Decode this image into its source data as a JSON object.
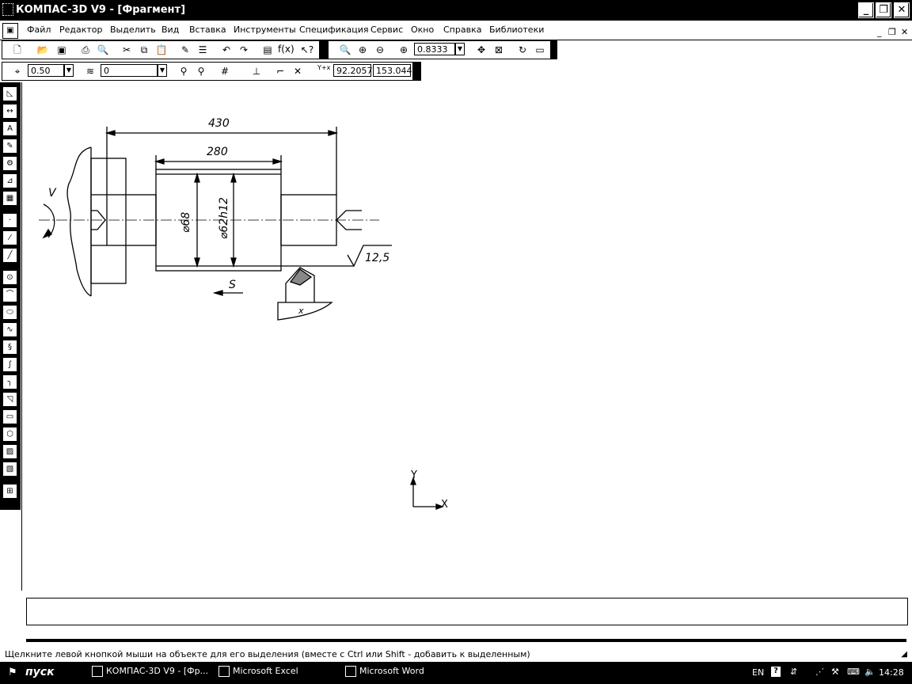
{
  "window": {
    "title": "КОМПАС-3D V9 - [Фрагмент]",
    "buttons": [
      "_",
      "❐",
      "✕"
    ],
    "doc_buttons": [
      "_",
      "❐",
      "✕"
    ]
  },
  "menu": {
    "items": [
      "Файл",
      "Редактор",
      "Выделить",
      "Вид",
      "Вставка",
      "Инструменты",
      "Спецификация",
      "Сервис",
      "Окно",
      "Справка",
      "Библиотеки"
    ]
  },
  "toolbar": {
    "zoom_value": "0.8333",
    "line_step": "0.50",
    "layer": "0",
    "coord_x": "92.2057",
    "coord_y": "153.044",
    "fx_label": "f(x)"
  },
  "drawing": {
    "dim_overall": "430",
    "dim_middle": "280",
    "dia_1": "⌀68",
    "dia_2": "⌀62h12",
    "roughness": "12,5",
    "feed_label": "S",
    "rotation_label": "V",
    "tool_label": "x",
    "axis_x": "X",
    "axis_y": "Y"
  },
  "status": {
    "hint": "Щелкните левой кнопкой мыши на объекте для его выделения (вместе с Ctrl или Shift - добавить к выделенным)"
  },
  "taskbar": {
    "start": "пуск",
    "tasks": [
      "КОМПАС-3D V9 - [Фр...",
      "Microsoft Excel",
      "Microsoft Word"
    ],
    "lang": "EN",
    "clock": "14:28"
  }
}
